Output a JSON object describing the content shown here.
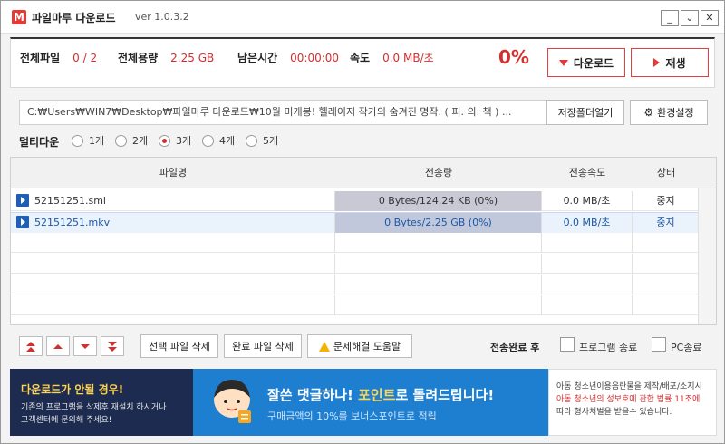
{
  "app": {
    "logo": "M",
    "title": "파일마루 다운로드",
    "version": "ver 1.0.3.2",
    "window_buttons": [
      "_",
      "⌄",
      "✕"
    ]
  },
  "status": {
    "files_label": "전체파일",
    "files_value": "0 / 2",
    "size_label": "전체용량",
    "size_value": "2.25  GB",
    "remaining_label": "남은시간",
    "remaining_value": "00:00:00",
    "speed_label": "속도",
    "speed_value": "0.0 MB/초",
    "percent": "0%",
    "download_label": "다운로드",
    "play_label": "재생"
  },
  "path": {
    "value": "C:₩Users₩WIN7₩Desktop₩파일마루 다운로드₩10월 미개봉! 헬레이저 작가의 숨겨진 명작. ( 피. 의. 책 ) ...",
    "open_folder_label": "저장폴더열기",
    "settings_label": "환경설정"
  },
  "multi": {
    "label": "멀티다운",
    "options": [
      "1개",
      "2개",
      "3개",
      "4개",
      "5개"
    ],
    "selected": "3개"
  },
  "table": {
    "headers": [
      "파일명",
      "전송량",
      "전송속도",
      "상태"
    ],
    "rows": [
      {
        "name": "52151251.smi",
        "transfer": "0  Bytes/124.24  KB (0%)",
        "speed": "0.0 MB/초",
        "status": "중지"
      },
      {
        "name": "52151251.mkv",
        "transfer": "0  Bytes/2.25  GB (0%)",
        "speed": "0.0 MB/초",
        "status": "중지"
      }
    ]
  },
  "toolbar": {
    "delete_selected_label": "선택 파일 삭제",
    "delete_done_label": "완료 파일 삭제",
    "help_label": "문제해결 도움말",
    "after_done_label": "전송완료 후",
    "exit_program_label": "프로그램 종료",
    "pc_shutdown_label": "PC종료"
  },
  "banner": {
    "left_title": "다운로드가 안될 경우!",
    "left_line1": "기존의 프로그램을 삭제후 재설치 하시거나",
    "left_line2": "고객센터에 문의해 주세요!",
    "mid_title_a": "잘쓴 댓글하나! ",
    "mid_title_hl": "포인트",
    "mid_title_b": "로 돌려드립니다!",
    "mid_sub": "구매금액의 10%를 보너스포인트로 적립",
    "right_line1": "아동 청소년이용음란물을 제작/배포/소지시",
    "right_line2": "아동 청소년의 성보호에 관한 법률 11조에",
    "right_line3": "따라 형사처벌을 받을수 있습니다."
  }
}
